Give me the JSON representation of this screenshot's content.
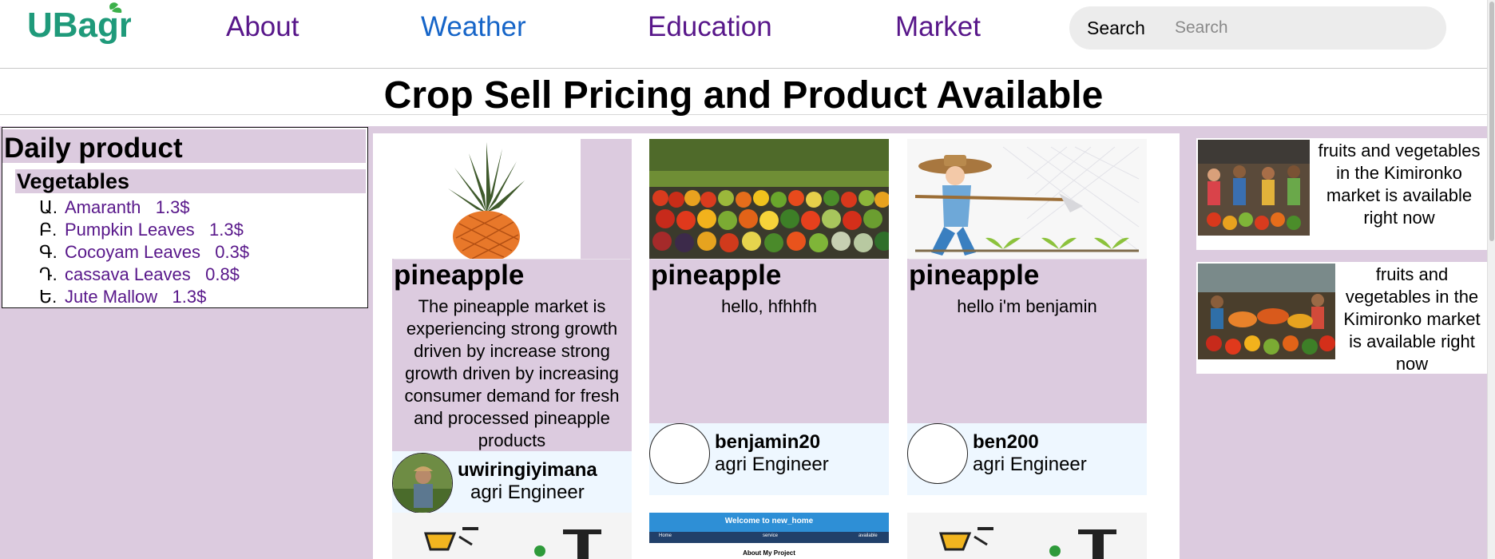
{
  "nav": {
    "logo_text": "UBagri",
    "links": [
      "About",
      "Weather",
      "Education",
      "Market"
    ],
    "search_label": "Search",
    "search_placeholder": "Search",
    "colors": {
      "brand": "#1f9a7a",
      "link_purple": "#58178a",
      "link_blue": "#1665c8"
    }
  },
  "page": {
    "title": "Crop Sell Pricing and Product Available",
    "accent_bg": "#dccbdf"
  },
  "sidebar": {
    "title": "Daily product",
    "category": "Vegetables",
    "items": [
      {
        "marker": "Ա.",
        "text": "Amaranth   1.3$"
      },
      {
        "marker": "Բ.",
        "text": "Pumpkin Leaves   1.3$"
      },
      {
        "marker": "Գ.",
        "text": "Cocoyam Leaves   0.3$"
      },
      {
        "marker": "Դ.",
        "text": "cassava Leaves   0.8$"
      },
      {
        "marker": "Ե.",
        "text": "Jute Mallow   1.3$"
      }
    ]
  },
  "cards": [
    {
      "image": "pineapple-image",
      "title": "pineapple",
      "description": "The pineapple market is experiencing strong growth driven by increase strong growth driven by increasing consumer demand for fresh and processed pineapple products",
      "author": "uwiringiyimana",
      "role": "agri Engineer"
    },
    {
      "image": "vegetables-image",
      "title": "pineapple",
      "description": "hello, hfhhfh",
      "author": "benjamin20",
      "role": "agri Engineer"
    },
    {
      "image": "farmer-image",
      "title": "pineapple",
      "description": "hello i'm benjamin",
      "author": "ben200",
      "role": "agri Engineer"
    }
  ],
  "peek": {
    "site_title": "Welcome to new_home",
    "nav_items": [
      "Home",
      "service",
      "available"
    ],
    "subtitle": "About My Project"
  },
  "side_cards": [
    {
      "image": "market-image",
      "text": "fruits and vegetables in the Kimironko market is available right now"
    },
    {
      "image": "market-stall-image",
      "text": "fruits and vegetables in the Kimironko market is available right now"
    }
  ]
}
